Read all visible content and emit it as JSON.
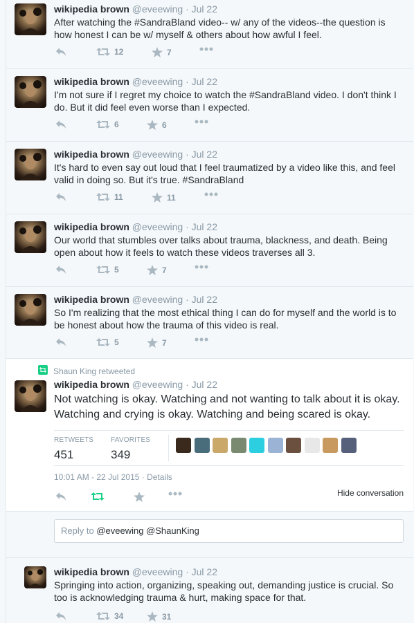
{
  "tweets_before": [
    {
      "name": "wikipedia brown",
      "handle": "@eveewing",
      "time": "Jul 22",
      "text": "After watching the #SandraBland video-- w/ any of the videos--the question is how honest I can be w/ myself & others about how awful I feel.",
      "retweets": "12",
      "favorites": "7"
    },
    {
      "name": "wikipedia brown",
      "handle": "@eveewing",
      "time": "Jul 22",
      "text": "I'm not sure if I regret my choice to watch the #SandraBland video. I don't think I do. But it did feel even worse than I expected.",
      "retweets": "6",
      "favorites": "6"
    },
    {
      "name": "wikipedia brown",
      "handle": "@eveewing",
      "time": "Jul 22",
      "text": "It's hard to even say out loud that I feel traumatized by a video like this, and feel valid in doing so. But it's true. #SandraBland",
      "retweets": "11",
      "favorites": "11"
    },
    {
      "name": "wikipedia brown",
      "handle": "@eveewing",
      "time": "Jul 22",
      "text": "Our world that stumbles over talks about trauma, blackness, and death. Being open about how it feels to watch these videos traverses all 3.",
      "retweets": "5",
      "favorites": "7"
    },
    {
      "name": "wikipedia brown",
      "handle": "@eveewing",
      "time": "Jul 22",
      "text": "So I'm realizing that the most ethical thing I can do for myself and the world is to be honest about how the trauma of this video is real.",
      "retweets": "5",
      "favorites": "7"
    }
  ],
  "expanded": {
    "retweeted_by": "Shaun King retweeted",
    "name": "wikipedia brown",
    "handle": "@eveewing",
    "time": "Jul 22",
    "text": "Not watching is okay. Watching and not wanting to talk about it is okay. Watching and crying is okay. Watching and being scared is okay.",
    "retweets_label": "RETWEETS",
    "retweets_count": "451",
    "favorites_label": "FAVORITES",
    "favorites_count": "349",
    "timestamp": "10:01 AM - 22 Jul 2015",
    "separator": "·",
    "details_link": "Details",
    "hide_conversation": "Hide conversation",
    "favoriters_colors": [
      "#3a2a1e",
      "#4a6d7c",
      "#c9a86a",
      "#7a8a70",
      "#2ccfe0",
      "#9bb4d6",
      "#6b5040",
      "#e8e8e8",
      "#c89a60",
      "#56607a"
    ]
  },
  "reply": {
    "prefix": "Reply to",
    "mentions": "@eveewing @ShaunKing"
  },
  "tweets_after": [
    {
      "name": "wikipedia brown",
      "handle": "@eveewing",
      "time": "Jul 22",
      "text": "Springing into action, organizing, speaking out, demanding justice is crucial. So too is acknowledging trauma & hurt, making space for that.",
      "retweets": "34",
      "favorites": "31"
    }
  ],
  "colors": {
    "background": "#f5f8fa",
    "border": "#e1e8ed",
    "icon_gray": "#aab8c2",
    "meta_gray": "#8899a6",
    "retweet_green": "#19cf86"
  }
}
